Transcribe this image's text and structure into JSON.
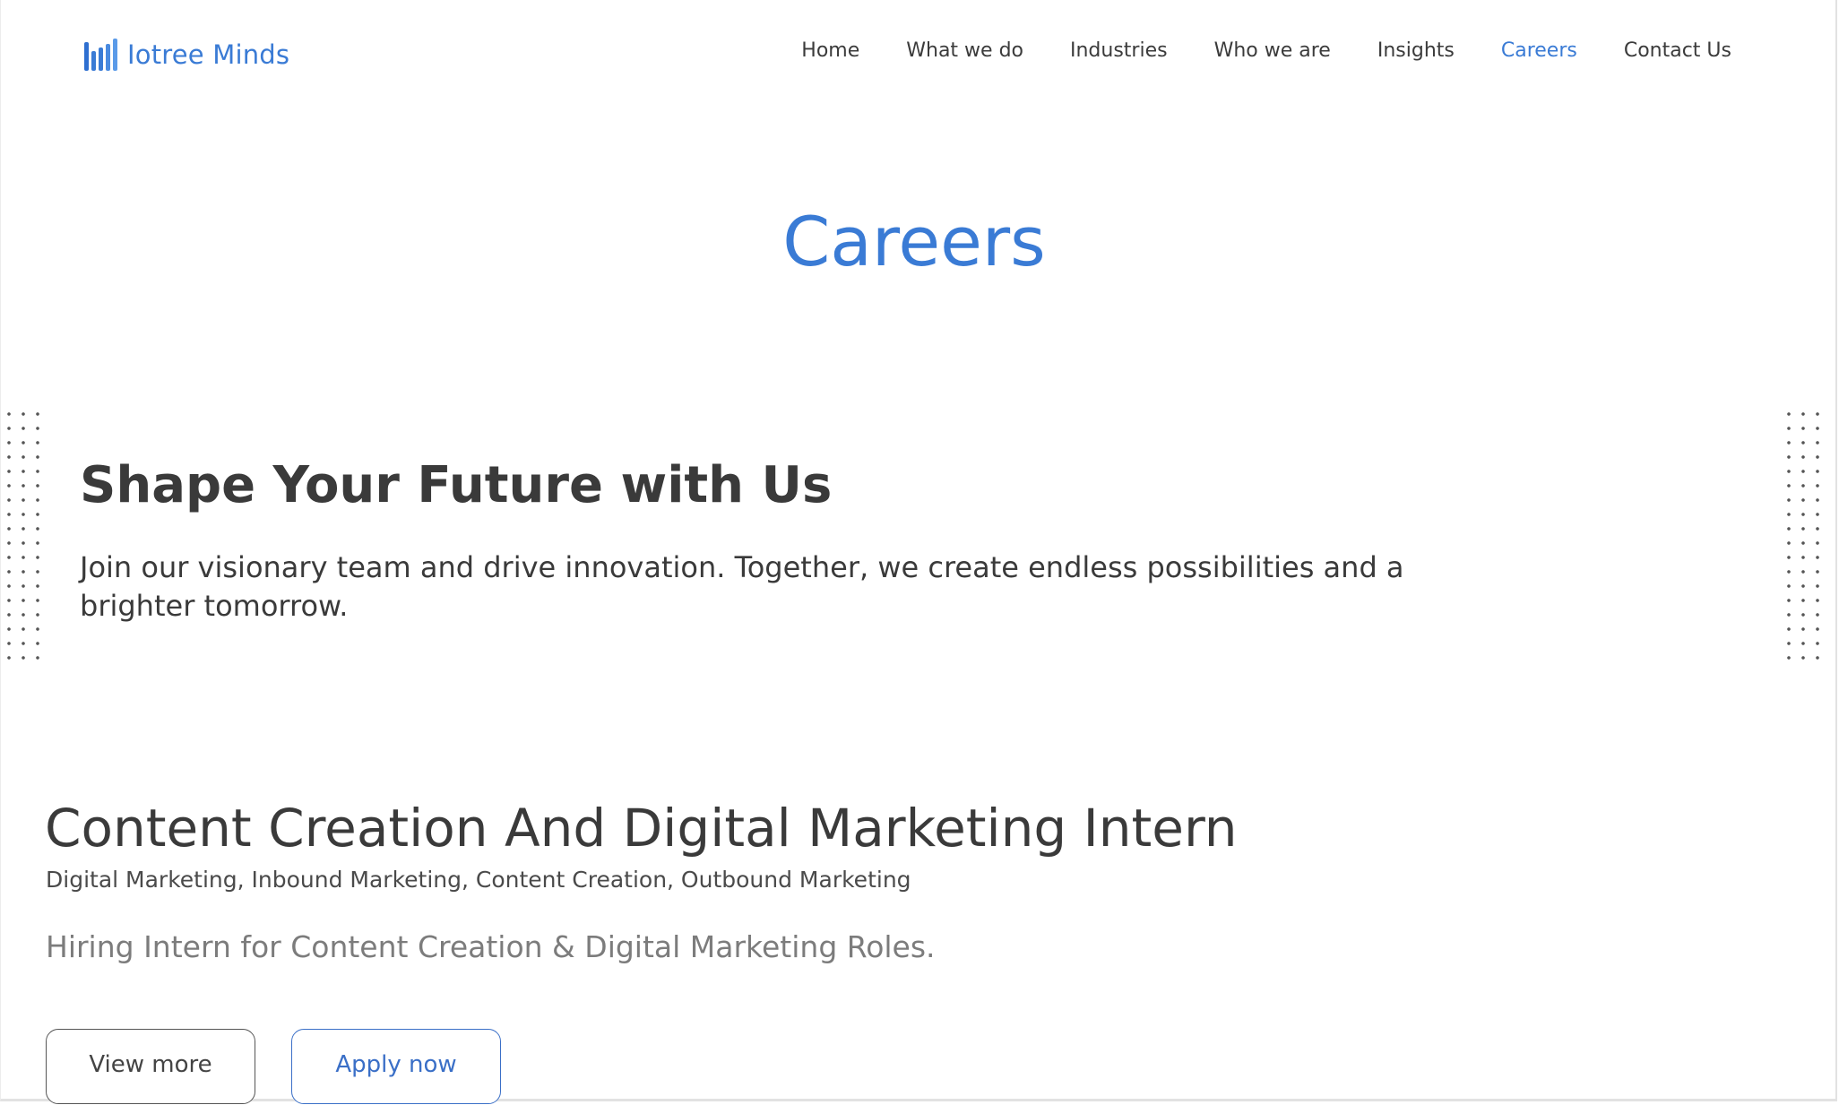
{
  "brand": {
    "name": "Iotree Minds",
    "color": "#3a7bd5",
    "icon": "bar-chart-logo-icon"
  },
  "nav": {
    "items": [
      {
        "label": "Home"
      },
      {
        "label": "What we do"
      },
      {
        "label": "Industries"
      },
      {
        "label": "Who we are"
      },
      {
        "label": "Insights"
      },
      {
        "label": "Careers",
        "active": true
      },
      {
        "label": "Contact Us"
      }
    ],
    "active_color": "#3a7bd5"
  },
  "page": {
    "title": "Careers"
  },
  "hero": {
    "heading": "Shape Your Future with Us",
    "subtext": "Join our visionary team and drive innovation. Together, we create endless possibilities and a brighter tomorrow."
  },
  "job": {
    "title": "Content Creation And Digital Marketing Intern",
    "tags": "Digital Marketing, Inbound Marketing, Content Creation, Outbound Marketing",
    "description": "Hiring Intern for Content Creation & Digital Marketing Roles.",
    "view_more_label": "View more",
    "apply_label": "Apply now"
  }
}
